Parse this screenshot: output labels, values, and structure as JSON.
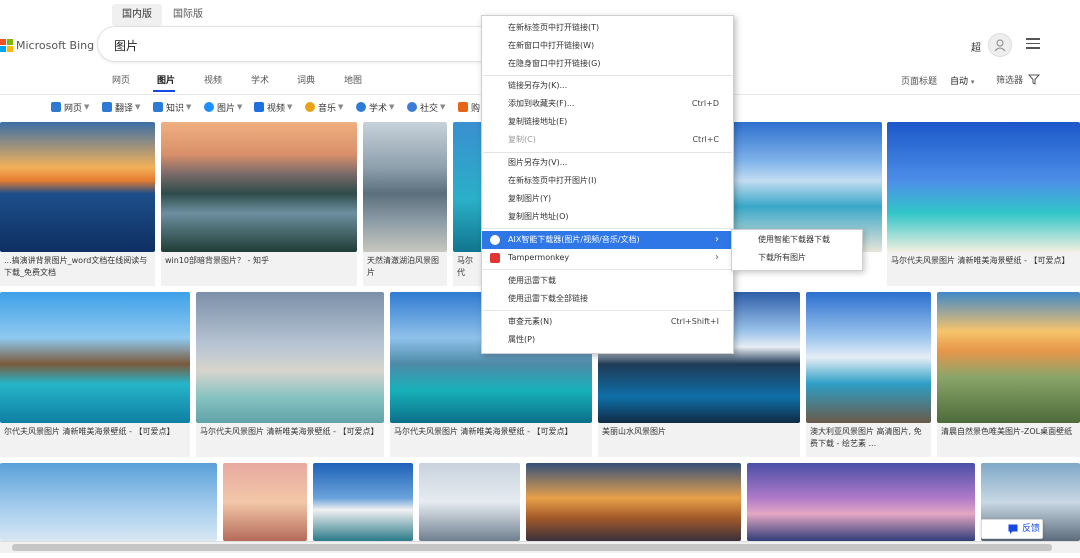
{
  "region_tabs": [
    "国内版",
    "国际版"
  ],
  "logo_text": "Microsoft Bing",
  "search": {
    "query": "图片"
  },
  "user": {
    "name": "超"
  },
  "nav_tabs": [
    "网页",
    "图片",
    "视频",
    "学术",
    "词典",
    "地图"
  ],
  "page_options": {
    "title_label": "页面标题",
    "auto_label": "自动",
    "filter_label": "筛选器"
  },
  "chips": [
    "网页",
    "翻译",
    "知识",
    "图片",
    "视频",
    "音乐",
    "学术",
    "社交",
    "购"
  ],
  "captions": {
    "r1c1": "...搞演讲背景图片_word文档在线阅读与下载_免费文档",
    "r1c2": "win10部暗背景图片？ - 知乎",
    "r1c3": "天然清澈湖泊风景图片",
    "r1c4": "马尔代",
    "r1c8": "马尔代夫风景图片 清新唯美海景壁纸 - 【可爱点】",
    "r2c1": "尔代夫风景图片 清新唯美海景壁纸 - 【可爱点】",
    "r2c2": "马尔代夫风景图片 清新唯美海景壁纸 - 【可爱点】",
    "r2c3": "马尔代夫风景图片 清新唯美海景壁纸 - 【可爱点】",
    "r2c4": "美丽山水风景图片",
    "r2c5": "澳大利亚风景图片 高清图片, 免费下载 - 绘艺素 ...",
    "r2c6": "清晨自然景色唯美图片-ZOL桌面壁纸"
  },
  "context_menu": {
    "items": [
      {
        "label": "在新标签页中打开链接(T)"
      },
      {
        "label": "在新窗口中打开链接(W)"
      },
      {
        "label": "在隐身窗口中打开链接(G)"
      },
      {
        "label": "链接另存为(K)..."
      },
      {
        "label": "添加到收藏夹(F)...",
        "shortcut": "Ctrl+D"
      },
      {
        "label": "复制链接地址(E)"
      },
      {
        "label": "复制(C)",
        "shortcut": "Ctrl+C"
      },
      {
        "label": "图片另存为(V)..."
      },
      {
        "label": "在新标签页中打开图片(I)"
      },
      {
        "label": "复制图片(Y)"
      },
      {
        "label": "复制图片地址(O)"
      },
      {
        "label": "AIX智能下载器(图片/视频/音乐/文档)"
      },
      {
        "label": "Tampermonkey"
      },
      {
        "label": "使用迅雷下载"
      },
      {
        "label": "使用迅雷下载全部链接"
      },
      {
        "label": "审查元素(N)",
        "shortcut": "Ctrl+Shift+I"
      },
      {
        "label": "属性(P)"
      }
    ],
    "submenu": [
      "使用智能下载器下载",
      "下载所有图片"
    ]
  },
  "feedback_label": "反馈",
  "colors": {
    "accent": "#174ae4",
    "menu_highlight": "#2f77e6"
  }
}
